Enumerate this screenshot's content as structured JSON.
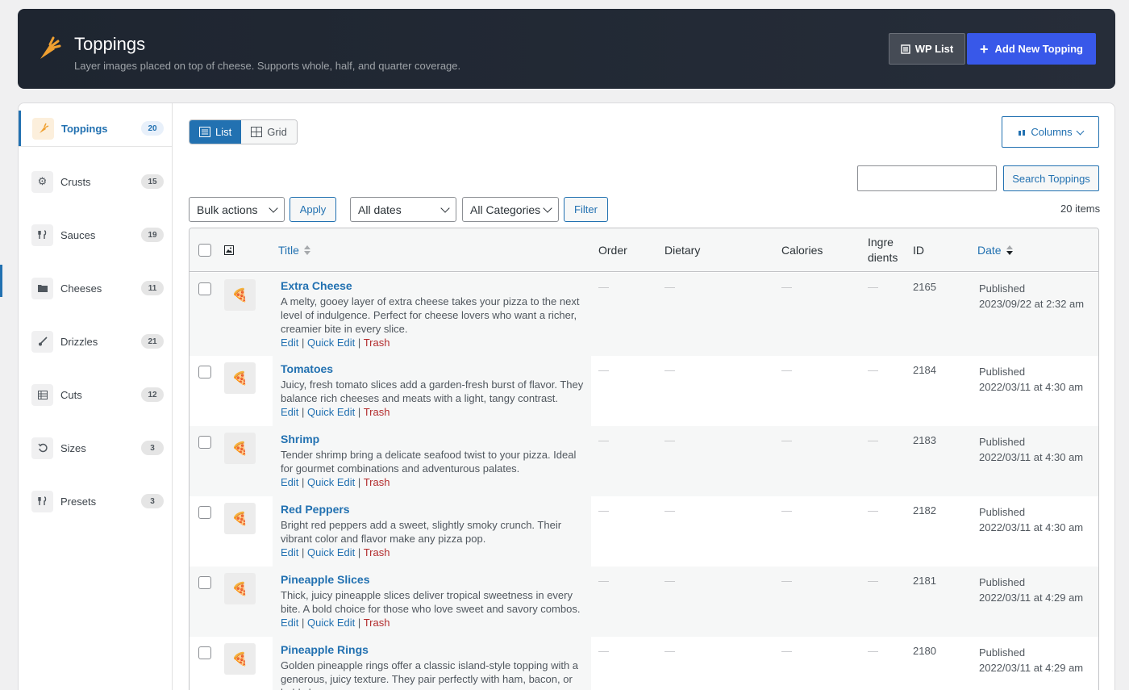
{
  "header": {
    "title": "Toppings",
    "subtitle": "Layer images placed on top of cheese. Supports whole, half, and quarter coverage.",
    "wp_list_label": "WP List",
    "add_new_label": "Add New Topping"
  },
  "sidebar": {
    "items": [
      {
        "label": "Toppings",
        "count": "20",
        "icon": "carrot-icon"
      },
      {
        "label": "Crusts",
        "count": "15",
        "icon": "gear-icon"
      },
      {
        "label": "Sauces",
        "count": "19",
        "icon": "utensils-icon"
      },
      {
        "label": "Cheeses",
        "count": "11",
        "icon": "folder-icon"
      },
      {
        "label": "Drizzles",
        "count": "21",
        "icon": "brush-icon"
      },
      {
        "label": "Cuts",
        "count": "12",
        "icon": "table-icon"
      },
      {
        "label": "Sizes",
        "count": "3",
        "icon": "undo-icon"
      },
      {
        "label": "Presets",
        "count": "3",
        "icon": "utensils-icon"
      }
    ]
  },
  "view_toggle": {
    "list": "List",
    "grid": "Grid"
  },
  "columns_label": "Columns",
  "search": {
    "placeholder": "",
    "button": "Search Toppings"
  },
  "filters": {
    "bulk_actions": "Bulk actions",
    "apply": "Apply",
    "all_dates": "All dates",
    "all_categories": "All Categories",
    "filter": "Filter",
    "items_count": "20 items"
  },
  "table": {
    "columns": {
      "title": "Title",
      "order": "Order",
      "dietary": "Dietary",
      "calories": "Calories",
      "ingredients_line1": "Ingre",
      "ingredients_line2": "dients",
      "id": "ID",
      "date": "Date"
    },
    "row_actions": {
      "edit": "Edit",
      "quick_edit": "Quick Edit",
      "trash": "Trash",
      "sep": "|"
    },
    "empty_value": "—",
    "rows": [
      {
        "title": "Extra Cheese",
        "desc": "A melty, gooey layer of extra cheese takes your pizza to the next level of indulgence. Perfect for cheese lovers who want a richer, creamier bite in every slice.",
        "id": "2165",
        "status": "Published",
        "date": "2023/09/22 at 2:32 am"
      },
      {
        "title": "Tomatoes",
        "desc": "Juicy, fresh tomato slices add a garden-fresh burst of flavor. They balance rich cheeses and meats with a light, tangy contrast.",
        "id": "2184",
        "status": "Published",
        "date": "2022/03/11 at 4:30 am"
      },
      {
        "title": "Shrimp",
        "desc": "Tender shrimp bring a delicate seafood twist to your pizza. Ideal for gourmet combinations and adventurous palates.",
        "id": "2183",
        "status": "Published",
        "date": "2022/03/11 at 4:30 am"
      },
      {
        "title": "Red Peppers",
        "desc": "Bright red peppers add a sweet, slightly smoky crunch. Their vibrant color and flavor make any pizza pop.",
        "id": "2182",
        "status": "Published",
        "date": "2022/03/11 at 4:30 am"
      },
      {
        "title": "Pineapple Slices",
        "desc": "Thick, juicy pineapple slices deliver tropical sweetness in every bite. A bold choice for those who love sweet and savory combos.",
        "id": "2181",
        "status": "Published",
        "date": "2022/03/11 at 4:29 am"
      },
      {
        "title": "Pineapple Rings",
        "desc": "Golden pineapple rings offer a classic island-style topping with a generous, juicy texture. They pair perfectly with ham, bacon, or bold cheeses.",
        "id": "2180",
        "status": "Published",
        "date": "2022/03/11 at 4:29 am"
      }
    ]
  }
}
